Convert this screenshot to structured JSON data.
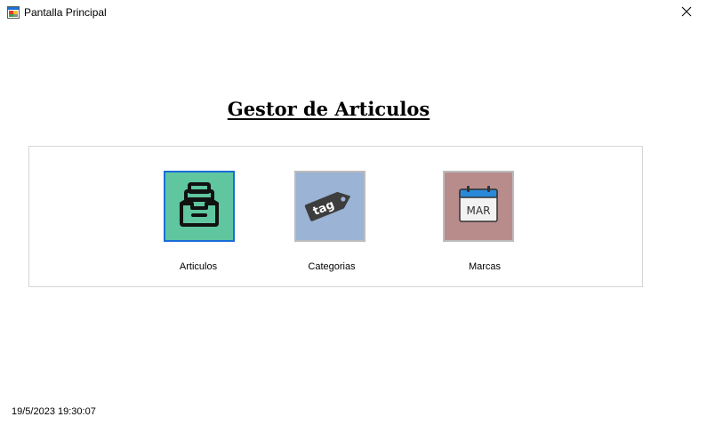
{
  "window": {
    "title": "Pantalla Principal",
    "app_icon": "app-window-icon",
    "close_icon": "close-icon"
  },
  "main": {
    "title": "Gestor de Articulos",
    "tiles": [
      {
        "label": "Articulos",
        "icon": "archive-drawer-icon",
        "color": "#5fc6a0",
        "focused": true
      },
      {
        "label": "Categorias",
        "icon": "tag-icon",
        "icon_text": "tag",
        "color": "#9bb3d4",
        "focused": false
      },
      {
        "label": "Marcas",
        "icon": "calendar-icon",
        "icon_text": "MAR",
        "color": "#b98c8c",
        "focused": false
      }
    ]
  },
  "status": {
    "datetime": "19/5/2023 19:30:07"
  },
  "colors": {
    "focus_border": "#1a6dd6",
    "panel_border": "#d6d6d6"
  }
}
